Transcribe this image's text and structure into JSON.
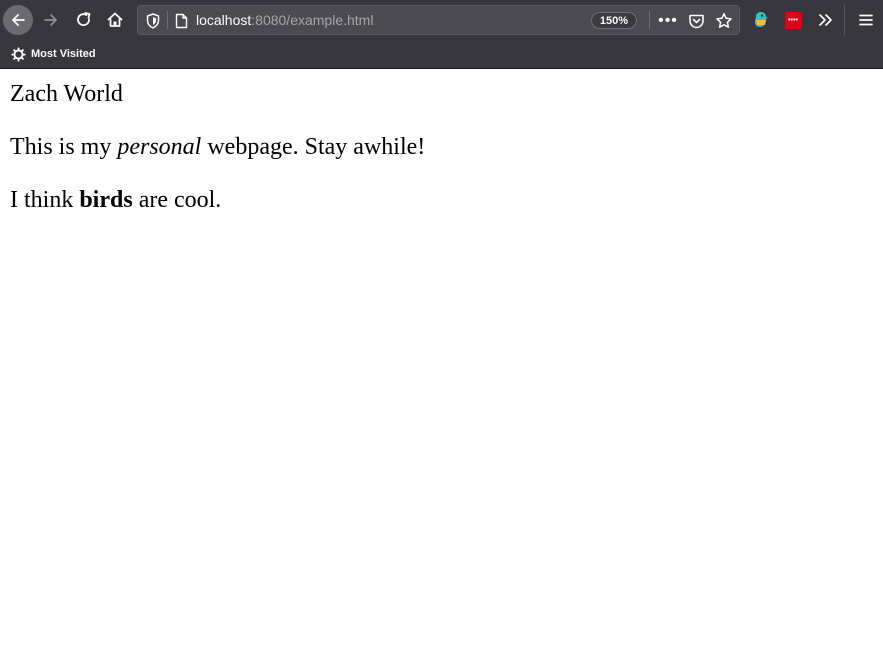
{
  "browser": {
    "url_host": "localhost",
    "url_rest": ":8080/example.html",
    "zoom": "150%",
    "page_actions_glyph": "•••",
    "bookmarks": {
      "most_visited_label": "Most Visited"
    },
    "extension_badge_text": "••••",
    "colors": {
      "toolbar": "#38373d",
      "urlbar": "#4b4a50",
      "extension_red": "#e0001a",
      "extension_teal": "#2ec4b6"
    }
  },
  "page": {
    "title": "Zach World",
    "intro": {
      "before": "This is my ",
      "emphasis": "personal",
      "after": " webpage. Stay awhile!"
    },
    "birds": {
      "before": "I think ",
      "strong": "birds",
      "after": " are cool."
    }
  }
}
